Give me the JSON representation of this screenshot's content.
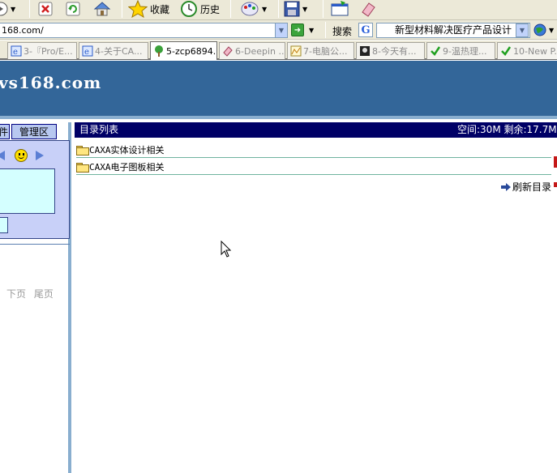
{
  "toolbar": {
    "favorites_label": "收藏",
    "history_label": "历史"
  },
  "address": {
    "url": "168.com/"
  },
  "search": {
    "label": "搜索",
    "engine_icon": "G",
    "query": "新型材料解决医疗产品设计"
  },
  "tabs": [
    {
      "label": "3-『Pro/E...",
      "icon": "ie-page-icon",
      "active": false
    },
    {
      "label": "4-关于CA...",
      "icon": "ie-page-icon",
      "active": false
    },
    {
      "label": "5-zcp6894...",
      "icon": "tree-icon",
      "active": true
    },
    {
      "label": "6-Deepin ...",
      "icon": "eraser-icon",
      "active": false
    },
    {
      "label": "7-电脑公...",
      "icon": "chart-icon",
      "active": false
    },
    {
      "label": "8-今天有...",
      "icon": "photo-icon",
      "active": false
    },
    {
      "label": "9-温热理...",
      "icon": "check-icon",
      "active": false
    },
    {
      "label": "10-New P...",
      "icon": "check-icon",
      "active": false
    }
  ],
  "site": {
    "title": "vs168.com"
  },
  "sidebar": {
    "tab_left": "件",
    "tab_manage": "管理区",
    "pager": {
      "next": "下页",
      "last": "尾页"
    }
  },
  "main": {
    "header_title": "目录列表",
    "space_info": "空间:30M 剩余:17.7M",
    "folders": [
      {
        "name": "CAXA实体设计相关"
      },
      {
        "name": "CAXA电子图板相关"
      }
    ],
    "refresh_label": "刷新目录"
  },
  "colors": {
    "banner": "#336699",
    "header": "#000066",
    "divider": "#6fb39f"
  }
}
